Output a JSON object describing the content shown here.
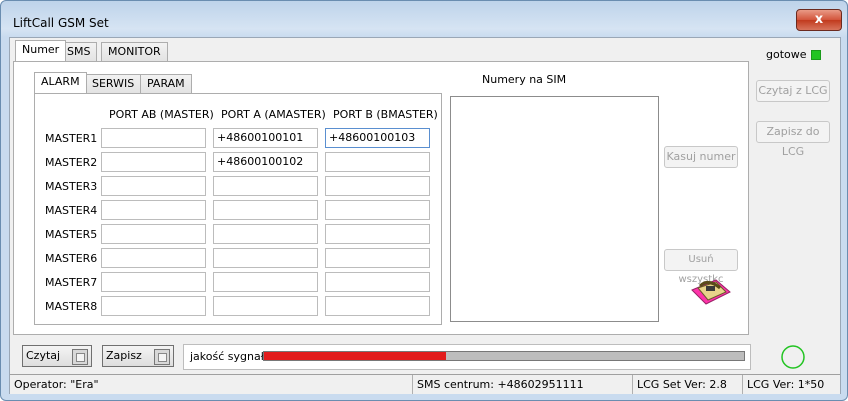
{
  "window": {
    "title": "LiftCall GSM Set",
    "close_glyph": "x"
  },
  "tabs": [
    "Numer",
    "SMS",
    "MONITOR"
  ],
  "subtabs": [
    "ALARM",
    "SERWIS",
    "PARAM"
  ],
  "status_indicator": {
    "label": "gotowe",
    "color": "#22c422"
  },
  "columns": [
    "PORT AB (MASTER)",
    "PORT A (AMASTER)",
    "PORT B (BMASTER)"
  ],
  "rows": [
    {
      "label": "MASTER1",
      "values": [
        "",
        "+48600100101",
        "+48600100103"
      ]
    },
    {
      "label": "MASTER2",
      "values": [
        "",
        "+48600100102",
        ""
      ]
    },
    {
      "label": "MASTER3",
      "values": [
        "",
        "",
        ""
      ]
    },
    {
      "label": "MASTER4",
      "values": [
        "",
        "",
        ""
      ]
    },
    {
      "label": "MASTER5",
      "values": [
        "",
        "",
        ""
      ]
    },
    {
      "label": "MASTER6",
      "values": [
        "",
        "",
        ""
      ]
    },
    {
      "label": "MASTER7",
      "values": [
        "",
        "",
        ""
      ]
    },
    {
      "label": "MASTER8",
      "values": [
        "",
        "",
        ""
      ]
    }
  ],
  "sim": {
    "label": "Numery na SIM"
  },
  "buttons": {
    "read_lcg": "Czytaj z LCG",
    "save_lcg": "Zapisz do LCG",
    "delete_number": "Kasuj numer",
    "delete_all": "Usuń wszystkc",
    "read": "Czytaj",
    "save": "Zapisz"
  },
  "signal": {
    "label": "jakość sygnału",
    "level_fraction": 0.38,
    "color": "#e21b1b"
  },
  "statusbar": {
    "operator": "Operator: \"Era\"",
    "sms_center": "SMS centrum: +48602951111",
    "set_ver": "LCG Set Ver: 2.8",
    "lcg_ver": "LCG Ver: 1*50"
  }
}
